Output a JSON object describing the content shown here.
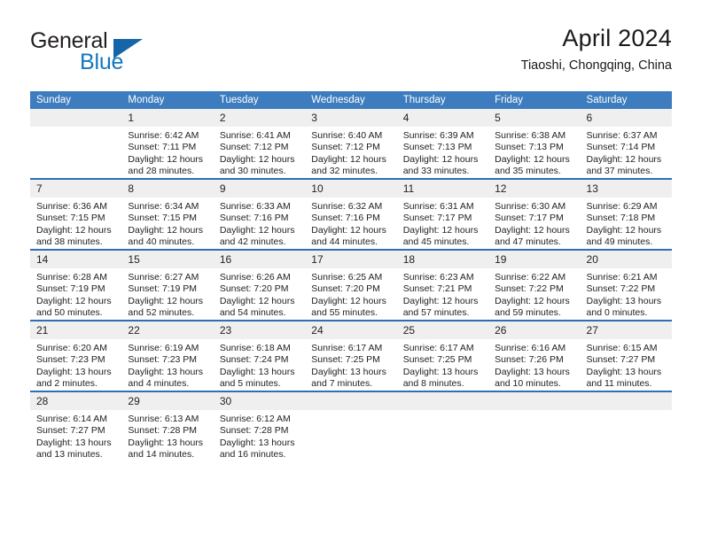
{
  "brand": {
    "name_part1": "General",
    "name_part2": "Blue",
    "triangle_icon": "triangle-icon",
    "accent_blue": "#1278be",
    "header_blue": "#3d7cbe"
  },
  "header": {
    "title": "April 2024",
    "location": "Tiaoshi, Chongqing, China"
  },
  "calendar": {
    "weekday_headers": [
      "Sunday",
      "Monday",
      "Tuesday",
      "Wednesday",
      "Thursday",
      "Friday",
      "Saturday"
    ],
    "weeks": [
      [
        {
          "day": "",
          "lines": [
            "",
            "",
            "",
            ""
          ],
          "empty": true
        },
        {
          "day": "1",
          "lines": [
            "Sunrise: 6:42 AM",
            "Sunset: 7:11 PM",
            "Daylight: 12 hours",
            "and 28 minutes."
          ]
        },
        {
          "day": "2",
          "lines": [
            "Sunrise: 6:41 AM",
            "Sunset: 7:12 PM",
            "Daylight: 12 hours",
            "and 30 minutes."
          ]
        },
        {
          "day": "3",
          "lines": [
            "Sunrise: 6:40 AM",
            "Sunset: 7:12 PM",
            "Daylight: 12 hours",
            "and 32 minutes."
          ]
        },
        {
          "day": "4",
          "lines": [
            "Sunrise: 6:39 AM",
            "Sunset: 7:13 PM",
            "Daylight: 12 hours",
            "and 33 minutes."
          ]
        },
        {
          "day": "5",
          "lines": [
            "Sunrise: 6:38 AM",
            "Sunset: 7:13 PM",
            "Daylight: 12 hours",
            "and 35 minutes."
          ]
        },
        {
          "day": "6",
          "lines": [
            "Sunrise: 6:37 AM",
            "Sunset: 7:14 PM",
            "Daylight: 12 hours",
            "and 37 minutes."
          ]
        }
      ],
      [
        {
          "day": "7",
          "lines": [
            "Sunrise: 6:36 AM",
            "Sunset: 7:15 PM",
            "Daylight: 12 hours",
            "and 38 minutes."
          ]
        },
        {
          "day": "8",
          "lines": [
            "Sunrise: 6:34 AM",
            "Sunset: 7:15 PM",
            "Daylight: 12 hours",
            "and 40 minutes."
          ]
        },
        {
          "day": "9",
          "lines": [
            "Sunrise: 6:33 AM",
            "Sunset: 7:16 PM",
            "Daylight: 12 hours",
            "and 42 minutes."
          ]
        },
        {
          "day": "10",
          "lines": [
            "Sunrise: 6:32 AM",
            "Sunset: 7:16 PM",
            "Daylight: 12 hours",
            "and 44 minutes."
          ]
        },
        {
          "day": "11",
          "lines": [
            "Sunrise: 6:31 AM",
            "Sunset: 7:17 PM",
            "Daylight: 12 hours",
            "and 45 minutes."
          ]
        },
        {
          "day": "12",
          "lines": [
            "Sunrise: 6:30 AM",
            "Sunset: 7:17 PM",
            "Daylight: 12 hours",
            "and 47 minutes."
          ]
        },
        {
          "day": "13",
          "lines": [
            "Sunrise: 6:29 AM",
            "Sunset: 7:18 PM",
            "Daylight: 12 hours",
            "and 49 minutes."
          ]
        }
      ],
      [
        {
          "day": "14",
          "lines": [
            "Sunrise: 6:28 AM",
            "Sunset: 7:19 PM",
            "Daylight: 12 hours",
            "and 50 minutes."
          ]
        },
        {
          "day": "15",
          "lines": [
            "Sunrise: 6:27 AM",
            "Sunset: 7:19 PM",
            "Daylight: 12 hours",
            "and 52 minutes."
          ]
        },
        {
          "day": "16",
          "lines": [
            "Sunrise: 6:26 AM",
            "Sunset: 7:20 PM",
            "Daylight: 12 hours",
            "and 54 minutes."
          ]
        },
        {
          "day": "17",
          "lines": [
            "Sunrise: 6:25 AM",
            "Sunset: 7:20 PM",
            "Daylight: 12 hours",
            "and 55 minutes."
          ]
        },
        {
          "day": "18",
          "lines": [
            "Sunrise: 6:23 AM",
            "Sunset: 7:21 PM",
            "Daylight: 12 hours",
            "and 57 minutes."
          ]
        },
        {
          "day": "19",
          "lines": [
            "Sunrise: 6:22 AM",
            "Sunset: 7:22 PM",
            "Daylight: 12 hours",
            "and 59 minutes."
          ]
        },
        {
          "day": "20",
          "lines": [
            "Sunrise: 6:21 AM",
            "Sunset: 7:22 PM",
            "Daylight: 13 hours",
            "and 0 minutes."
          ]
        }
      ],
      [
        {
          "day": "21",
          "lines": [
            "Sunrise: 6:20 AM",
            "Sunset: 7:23 PM",
            "Daylight: 13 hours",
            "and 2 minutes."
          ]
        },
        {
          "day": "22",
          "lines": [
            "Sunrise: 6:19 AM",
            "Sunset: 7:23 PM",
            "Daylight: 13 hours",
            "and 4 minutes."
          ]
        },
        {
          "day": "23",
          "lines": [
            "Sunrise: 6:18 AM",
            "Sunset: 7:24 PM",
            "Daylight: 13 hours",
            "and 5 minutes."
          ]
        },
        {
          "day": "24",
          "lines": [
            "Sunrise: 6:17 AM",
            "Sunset: 7:25 PM",
            "Daylight: 13 hours",
            "and 7 minutes."
          ]
        },
        {
          "day": "25",
          "lines": [
            "Sunrise: 6:17 AM",
            "Sunset: 7:25 PM",
            "Daylight: 13 hours",
            "and 8 minutes."
          ]
        },
        {
          "day": "26",
          "lines": [
            "Sunrise: 6:16 AM",
            "Sunset: 7:26 PM",
            "Daylight: 13 hours",
            "and 10 minutes."
          ]
        },
        {
          "day": "27",
          "lines": [
            "Sunrise: 6:15 AM",
            "Sunset: 7:27 PM",
            "Daylight: 13 hours",
            "and 11 minutes."
          ]
        }
      ],
      [
        {
          "day": "28",
          "lines": [
            "Sunrise: 6:14 AM",
            "Sunset: 7:27 PM",
            "Daylight: 13 hours",
            "and 13 minutes."
          ]
        },
        {
          "day": "29",
          "lines": [
            "Sunrise: 6:13 AM",
            "Sunset: 7:28 PM",
            "Daylight: 13 hours",
            "and 14 minutes."
          ]
        },
        {
          "day": "30",
          "lines": [
            "Sunrise: 6:12 AM",
            "Sunset: 7:28 PM",
            "Daylight: 13 hours",
            "and 16 minutes."
          ]
        },
        {
          "day": "",
          "lines": [
            "",
            "",
            "",
            ""
          ],
          "empty": true
        },
        {
          "day": "",
          "lines": [
            "",
            "",
            "",
            ""
          ],
          "empty": true
        },
        {
          "day": "",
          "lines": [
            "",
            "",
            "",
            ""
          ],
          "empty": true
        },
        {
          "day": "",
          "lines": [
            "",
            "",
            "",
            ""
          ],
          "empty": true
        }
      ]
    ]
  }
}
